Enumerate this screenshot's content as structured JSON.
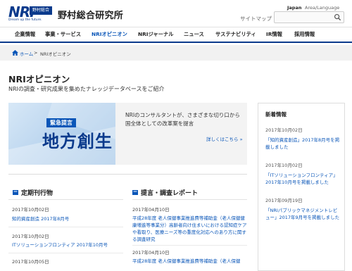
{
  "header": {
    "logo_text": "NRI",
    "logo_tag": "野村総合",
    "logo_sub": "Dream up the future.",
    "company_name": "野村総合研究所",
    "sitemap_label": "サイトマップ",
    "lang_jp": "Japan",
    "lang_area": "Area/Language",
    "search_placeholder": "",
    "colors": {
      "brand": "#0a3a8c",
      "link": "#0a56b8",
      "nav_border": "#0a3a8c"
    }
  },
  "nav": {
    "items": [
      {
        "label": "企業情報"
      },
      {
        "label": "事業・サービス"
      },
      {
        "label": "NRIオピニオン"
      },
      {
        "label": "NRIジャーナル"
      },
      {
        "label": "ニュース"
      },
      {
        "label": "サステナビリティ"
      },
      {
        "label": "IR情報"
      },
      {
        "label": "採用情報"
      }
    ],
    "active": "NRIオピニオン"
  },
  "breadcrumb": {
    "home": "ホーム",
    "separator": ">",
    "current": "NRIオピニオン"
  },
  "page": {
    "title": "NRIオピニオン",
    "description": "NRIの調査・研究成果を集めたナレッジデータベースをご紹介"
  },
  "banner": {
    "kicker": "緊急提言",
    "main": "地方創生",
    "text": "NRIのコンサルタントが、さまざまな切り口から国全体としての改革案を提言",
    "link": "詳しくはこちら »"
  },
  "side": {
    "title": "新着情報",
    "items": [
      {
        "date": "2017年10月02日",
        "text": "「知的資産創造」2017年8月号を掲載しました"
      },
      {
        "date": "2017年10月02日",
        "text": "「ITソリューションフロンティア」2017年10月号を掲載しました"
      },
      {
        "date": "2017年09月19日",
        "text": "「NRIパブリックマネジメントレビュー」2017年9月号を掲載しました"
      }
    ]
  },
  "periodicals": {
    "heading": "定期刊行物",
    "rows": [
      {
        "date": "2017年10月02日",
        "text": "知的資産創造 2017年8月号"
      },
      {
        "date": "2017年10月02日",
        "text": "ITソリューションフロンティア 2017年10月号"
      },
      {
        "date": "2017年10月05日",
        "text": ""
      }
    ]
  },
  "reports": {
    "heading": "提言・調査レポート",
    "rows": [
      {
        "date": "2017年04月10日",
        "text": "平成28年度 老人保健事業推進費等補助金（老人保健健康増進等事業分）高齢者向け住まいにおける認知症ケアや看取り、医療ニーズ等の重度化対応へのあり方に関する調査研究"
      },
      {
        "date": "2017年04月10日",
        "text": "平成28年度 老人保健事業推進費等補助金（老人保健"
      }
    ]
  }
}
